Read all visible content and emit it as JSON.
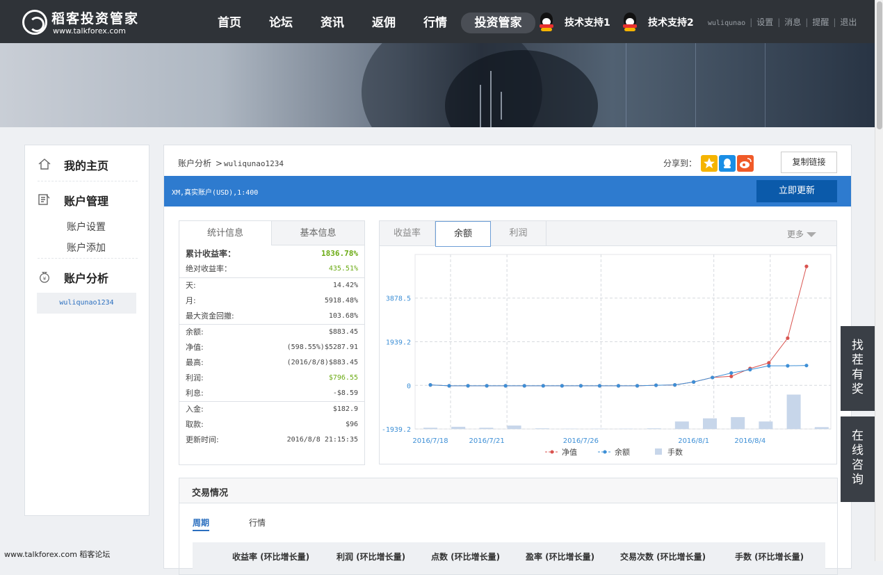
{
  "logo": {
    "cn": "稻客投资管家",
    "en": "www.talkforex.com"
  },
  "nav": [
    {
      "label": "首页"
    },
    {
      "label": "论坛"
    },
    {
      "label": "资讯"
    },
    {
      "label": "返佣"
    },
    {
      "label": "行情"
    },
    {
      "label": "投资管家"
    }
  ],
  "support": [
    "技术支持1",
    "技术支持2"
  ],
  "user": {
    "name": "wuliqunao",
    "links": [
      "设置",
      "消息",
      "提醒",
      "退出"
    ]
  },
  "sidebar": {
    "home": "我的主页",
    "account_mgmt": "账户管理",
    "sub_items": [
      "账户设置",
      "账户添加"
    ],
    "analysis": "账户分析",
    "account": "wuliqunao1234"
  },
  "main": {
    "crumb": "账户分析",
    "crumb_account": "wuliqunao1234",
    "share_label": "分享到：",
    "copy_link": "复制链接",
    "account_info": "XM,真实账户(USD),1:400",
    "update_btn": "立即更新"
  },
  "stats": {
    "tabs": [
      "统计信息",
      "基本信息"
    ],
    "rows": [
      {
        "label": "累计收益率：",
        "value": "1836.78%"
      },
      {
        "label": "绝对收益率：",
        "value": "435.51%"
      },
      {
        "label": "天:",
        "value": "14.42%"
      },
      {
        "label": "月:",
        "value": "5918.48%"
      },
      {
        "label": "最大资金回撤:",
        "value": "103.68%"
      },
      {
        "label": "余额:",
        "value": "$883.45"
      },
      {
        "label": "净值:",
        "value": "(598.55%)$5287.91"
      },
      {
        "label": "最高:",
        "value": "(2016/8/8)$883.45"
      },
      {
        "label": "利润:",
        "value": "$796.55"
      },
      {
        "label": "利息:",
        "value": "-$8.59"
      },
      {
        "label": "入金:",
        "value": "$182.9"
      },
      {
        "label": "取款:",
        "value": "$96"
      },
      {
        "label": "更新时间:",
        "value": "2016/8/8 21:15:35"
      }
    ]
  },
  "chart_tabs": [
    "收益率",
    "余额",
    "利润"
  ],
  "chart_more": "更多",
  "chart_data": {
    "type": "line",
    "x": [
      "2016/7/18",
      "2016/7/19",
      "2016/7/20",
      "2016/7/21",
      "2016/7/22",
      "2016/7/23",
      "2016/7/24",
      "2016/7/25",
      "2016/7/26",
      "2016/7/27",
      "2016/7/28",
      "2016/7/29",
      "2016/7/30",
      "2016/7/31",
      "2016/8/1",
      "2016/8/2",
      "2016/8/3",
      "2016/8/4",
      "2016/8/5",
      "2016/8/6",
      "2016/8/7",
      "2016/8/8"
    ],
    "tick_labels": [
      "2016/7/18",
      "2016/7/21",
      "2016/7/26",
      "2016/8/1",
      "2016/8/4"
    ],
    "y_ticks": [
      -1939.2,
      0,
      1939.2,
      3878.5
    ],
    "ylim": [
      -1939.2,
      5817.7
    ],
    "series": [
      {
        "name": "净值",
        "color": "#d9534f",
        "values": [
          20,
          -20,
          -20,
          -20,
          -20,
          -20,
          -20,
          -20,
          -20,
          -20,
          -20,
          -20,
          5,
          20,
          150,
          350,
          400,
          750,
          1000,
          2100,
          5288,
          null
        ]
      },
      {
        "name": "余额",
        "color": "#3d8fd6",
        "values": [
          20,
          -20,
          -20,
          -20,
          -20,
          -20,
          -20,
          -20,
          -20,
          -20,
          -20,
          -20,
          5,
          20,
          150,
          350,
          550,
          700,
          870,
          870,
          883,
          null
        ]
      },
      {
        "name": "手数",
        "color": "#c7d6ea",
        "bar_values": [
          0.2,
          0.35,
          0.2,
          0.55,
          0.1,
          0.05,
          0.05,
          0.05,
          0.1,
          1.2,
          1.7,
          1.9,
          1.2,
          5.5,
          0.3,
          0.3
        ]
      }
    ]
  },
  "trade": {
    "title": "交易情况",
    "tabs": [
      "周期",
      "行情"
    ],
    "headers": [
      "收益率 (环比增长量)",
      "利润 (环比增长量)",
      "点数 (环比增长量)",
      "盈率 (环比增长量)",
      "交易次数 (环比增长量)",
      "手数 (环比增长量)"
    ]
  },
  "float": [
    "找茬有奖",
    "在线咨询"
  ],
  "footer": "www.talkforex.com 稻客论坛",
  "colors": {
    "nav_bg": "#2f3338",
    "accent_blue": "#2e7bcf",
    "update_btn": "#0b5aaa",
    "green": "#6aaa12"
  }
}
